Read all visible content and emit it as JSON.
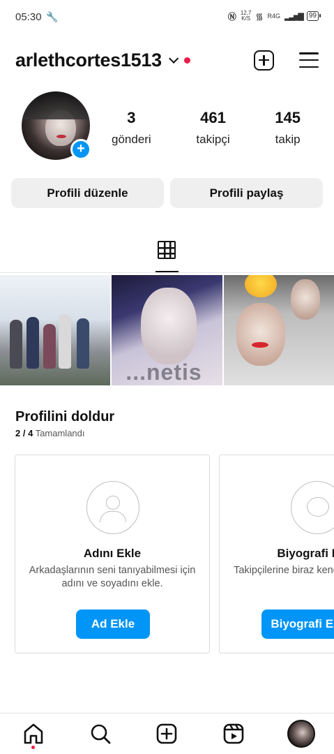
{
  "status_bar": {
    "time": "05:30",
    "net_speed_value": "12,7",
    "net_speed_unit": "K/S",
    "network": "R4G",
    "battery": "99"
  },
  "header": {
    "username": "arlethcortes1513"
  },
  "stats": [
    {
      "value": "3",
      "label": "gönderi"
    },
    {
      "value": "461",
      "label": "takipçi"
    },
    {
      "value": "145",
      "label": "takip"
    }
  ],
  "buttons": {
    "edit_profile": "Profili düzenle",
    "share_profile": "Profili paylaş"
  },
  "posts": {
    "post2_watermark": "...netis"
  },
  "complete_profile": {
    "title": "Profilini doldur",
    "progress": "2 / 4",
    "progress_label": "Tamamlandı",
    "cards": [
      {
        "title": "Adını Ekle",
        "description": "Arkadaşlarının seni tanıyabilmesi için adını ve soyadını ekle.",
        "button": "Ad Ekle"
      },
      {
        "title": "Biyografi Ekle",
        "description": "Takipçilerine biraz kendinden bahset.",
        "button": "Biyografi Ekle"
      }
    ]
  },
  "colors": {
    "accent": "#0095f6",
    "notification": "#ee1d45",
    "button_bg": "#efefef"
  }
}
